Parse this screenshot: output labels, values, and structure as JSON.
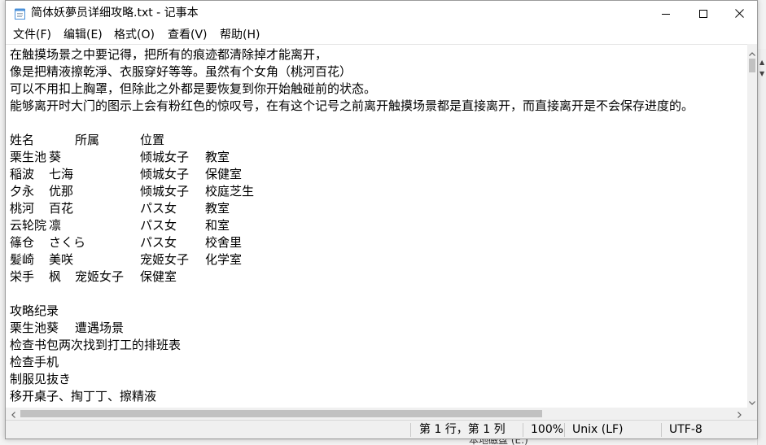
{
  "window": {
    "title": "简体妖夢员详细攻略.txt - 记事本",
    "icon": "notepad-icon",
    "controls": {
      "minimize": "minimize-icon",
      "maximize": "maximize-icon",
      "close": "close-icon"
    }
  },
  "menu": {
    "items": [
      {
        "label": "文件(F)"
      },
      {
        "label": "编辑(E)"
      },
      {
        "label": "格式(O)"
      },
      {
        "label": "查看(V)"
      },
      {
        "label": "帮助(H)"
      }
    ]
  },
  "editor": {
    "lines": [
      "在触摸场景之中要记得，把所有的痕迹都清除掉才能离开，",
      "像是把精液擦乾淨、衣服穿好等等。虽然有个女角（桃河百花）",
      "可以不用扣上胸罩，但除此之外都是要恢复到你开始触碰前的状态。",
      "能够离开时大门的图示上会有粉红色的惊叹号，在有这个记号之前离开触摸场景都是直接离开，而直接离开是不会保存进度的。",
      "",
      "姓名\t\t所属\t\t位置",
      "栗生池\t葵\t\t倾城女子\t教室",
      "稲波\t七海\t\t倾城女子\t保健室",
      "夕永\t优那\t\t倾城女子\t校庭芝生",
      "桃河\t百花\t\tパス女\t\t教室",
      "云轮院\t凛\t\tパス女\t\t和室",
      "篠仓\tさくら\t\tパス女\t\t校舍里",
      "髪崎\t美咲\t\t宠姬女子\t化学室",
      "栄手\t枫\t宠姬女子\t保健室",
      "",
      "攻略纪录",
      "栗生池葵\t遭遇场景",
      "检查书包两次找到打工的排班表",
      "检查手机",
      "制服见抜き",
      "移开桌子、掏丁丁、擦精液"
    ]
  },
  "scrollbars": {
    "vertical": {
      "up": "chevron-up-icon",
      "down": "chevron-down-icon"
    },
    "horizontal": {
      "left": "chevron-left-icon",
      "right": "chevron-right-icon"
    }
  },
  "status": {
    "position": "第 1 行，第 1 列",
    "zoom": "100%",
    "line_ending": "Unix (LF)",
    "encoding": "UTF-8"
  },
  "background": {
    "partial_text": "本地磁盘 (E:)"
  }
}
